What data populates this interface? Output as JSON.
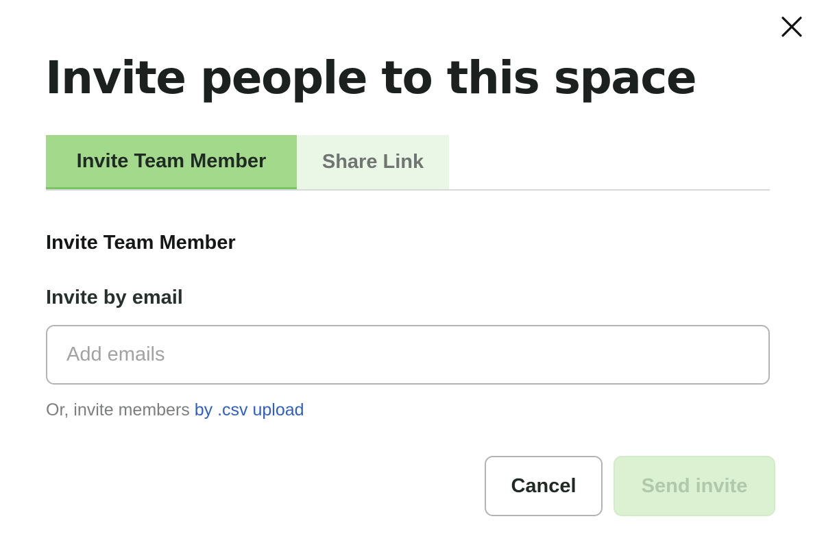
{
  "dialog": {
    "title": "Invite people to this space",
    "close_icon": "close-icon"
  },
  "tabs": [
    {
      "label": "Invite Team Member",
      "active": true
    },
    {
      "label": "Share Link",
      "active": false
    }
  ],
  "section": {
    "heading": "Invite Team Member",
    "email_label": "Invite by email",
    "email_input": {
      "value": "",
      "placeholder": "Add emails"
    },
    "helper_prefix": "Or, invite members ",
    "helper_link": "by .csv upload"
  },
  "actions": {
    "cancel_label": "Cancel",
    "send_label": "Send invite",
    "send_disabled": true
  },
  "colors": {
    "tab_active_bg": "#a2d98a",
    "tab_inactive_bg": "#ebf7e6",
    "link": "#2f5fc4",
    "send_disabled_bg": "#dbf1d2"
  }
}
